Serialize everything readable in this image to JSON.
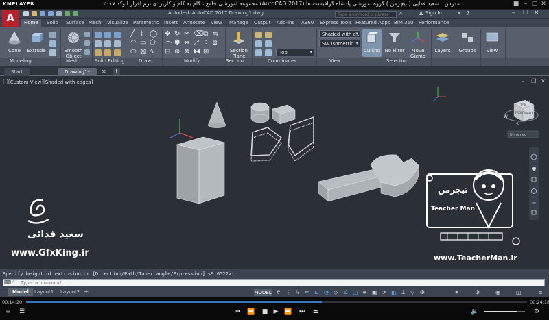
{
  "player": {
    "logo": "KMPLAYER",
    "title": "مجموعه آموزشی جامع ، گام به گام و کاربردی نرم افزار اتوکد ۲۰۱۷ (AutoCAD 2017) مدرس : سعید فدایی ( تیچرمن ) گروه آموزشی پادشاه گرافیست ها",
    "time_elapsed": "00:14:20",
    "time_total": "00:24:18",
    "progress": 0.59,
    "volume": 0.8
  },
  "app": {
    "logo": "A",
    "title": "Autodesk AutoCAD 2017   Drawing1.dwg",
    "search_placeholder": "Type a keyword or phrase",
    "signin": "Sign In"
  },
  "ribbon_tabs": [
    "Home",
    "Solid",
    "Surface",
    "Mesh",
    "Visualize",
    "Parametric",
    "Insert",
    "Annotate",
    "View",
    "Manage",
    "Output",
    "Add-ins",
    "A360",
    "Express Tools",
    "Featured Apps",
    "BIM 360",
    "Performance"
  ],
  "ribbon": {
    "cone": "Cone",
    "extrude": "Extrude",
    "smooth_object_1": "Smooth",
    "smooth_object_2": "Object",
    "section_plane_1": "Section",
    "section_plane_2": "Plane",
    "visual_style": "Shaded with e...",
    "view_preset": "SW Isometric",
    "ucs_dropdown": "Top",
    "culling": "Culling",
    "no_filter": "No Filter",
    "move_gizmo_1": "Move",
    "move_gizmo_2": "Gizmo",
    "layers": "Layers",
    "groups": "Groups",
    "view": "View",
    "panels": [
      "Modeling",
      "Mesh",
      "Solid Editing",
      "Draw",
      "Modify",
      "Section",
      "Coordinates",
      "View",
      "Selection"
    ]
  },
  "file_tabs": [
    "Start",
    "Drawing1*"
  ],
  "viewport": {
    "label": "[-][Custom View][Shaded with edges]",
    "viewcube_top": "TOP",
    "viewcube_front": "FRONT",
    "viewcube_right": "RIGHT",
    "compass_n": "N",
    "compass_w": "W",
    "compass_s": "S",
    "unnamed": "Unnamed"
  },
  "command": {
    "history": "Specify height of extrusion or [Direction/Path/Taper angle/Expression] <9.6522>:",
    "placeholder": "Type a command"
  },
  "layout_tabs": [
    "Model",
    "Layout1",
    "Layout2"
  ],
  "status": {
    "model": "MODEL"
  },
  "watermark": {
    "author": "سعید فدائی",
    "site_left": "www.GfxKing.ir",
    "brand": "تیچرمن",
    "brand_en": "Teacher Man",
    "site_right": "www.TeacherMan.ir"
  },
  "colors": {
    "accent": "#3a76c4",
    "autocad_red": "#b8202c"
  }
}
